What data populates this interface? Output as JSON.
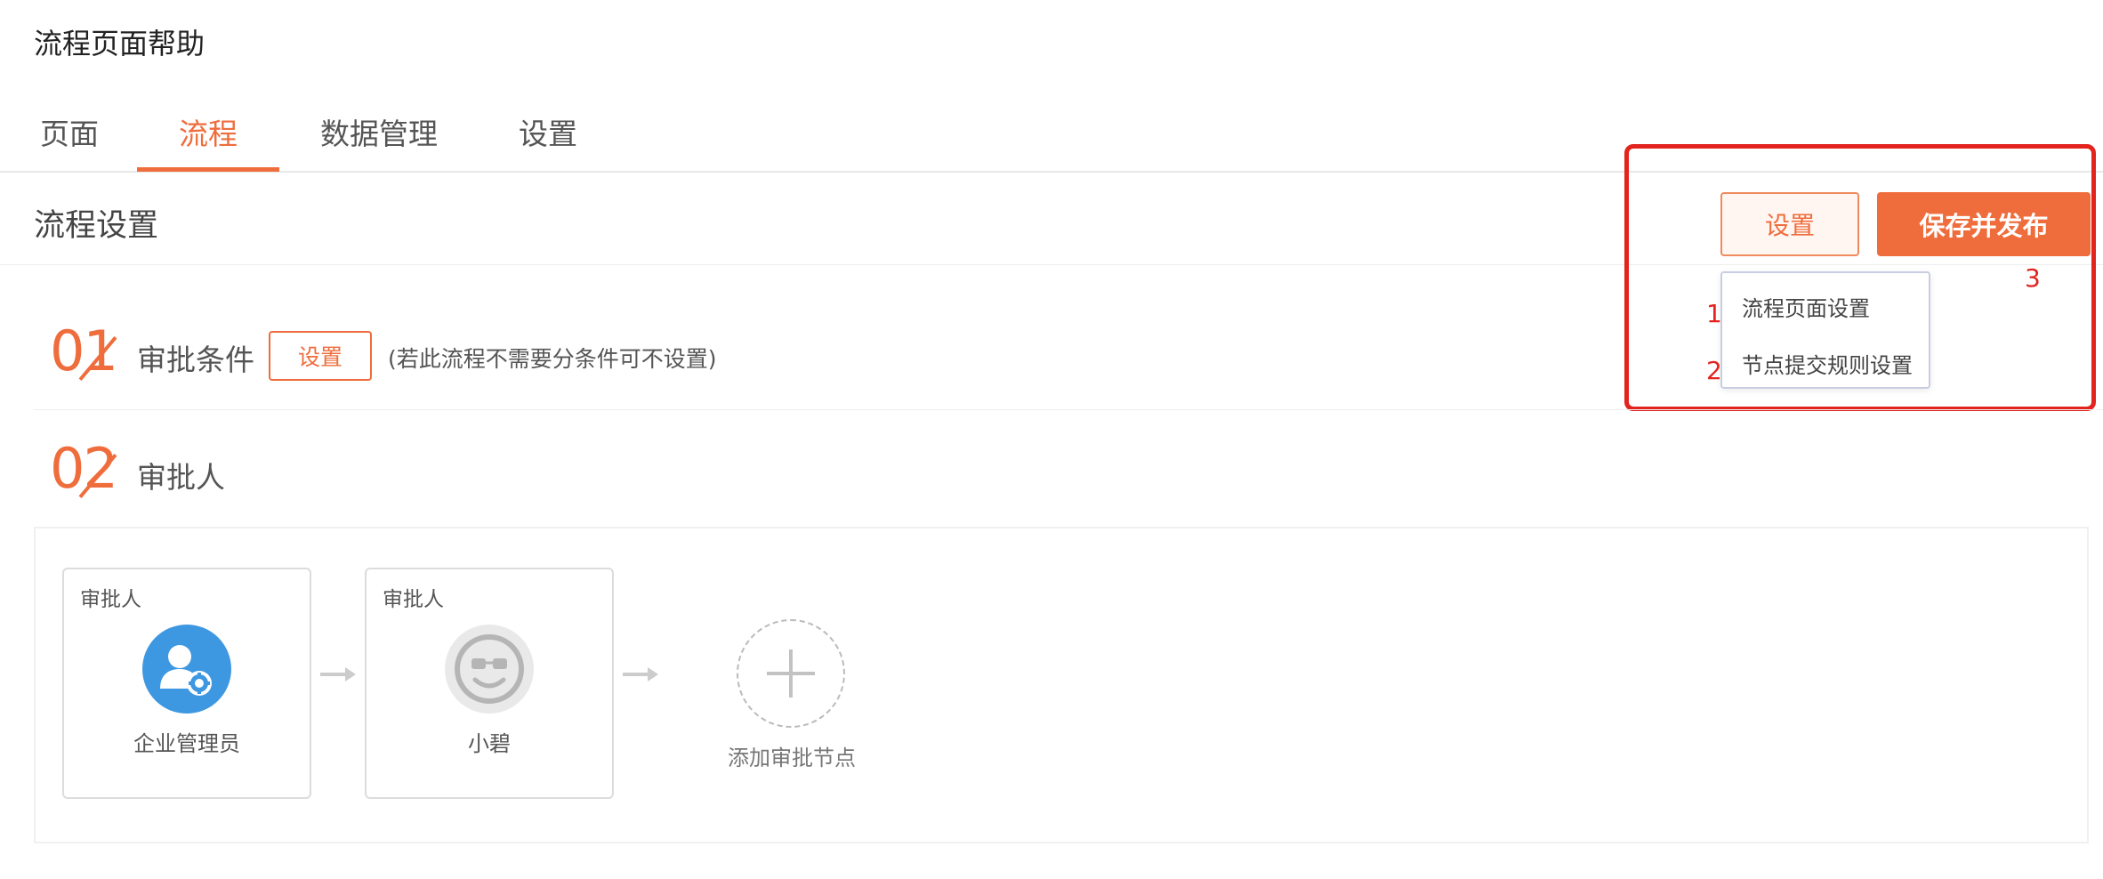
{
  "header": {
    "title": "流程页面帮助"
  },
  "tabs": [
    {
      "label": "页面"
    },
    {
      "label": "流程"
    },
    {
      "label": "数据管理"
    },
    {
      "label": "设置"
    }
  ],
  "toolbar": {
    "section_title": "流程设置",
    "settings_label": "设置",
    "publish_label": "保存并发布"
  },
  "dropdown": {
    "items": [
      {
        "label": "流程页面设置"
      },
      {
        "label": "节点提交规则设置"
      }
    ]
  },
  "annotations": {
    "n1": "1",
    "n2": "2",
    "n3": "3"
  },
  "steps": [
    {
      "number": "01",
      "label": "审批条件",
      "button": "设置",
      "note": "(若此流程不需要分条件可不设置)"
    },
    {
      "number": "02",
      "label": "审批人"
    }
  ],
  "flow": {
    "nodes": [
      {
        "title": "审批人",
        "name": "企业管理员",
        "icon": "admin-user-gear-icon"
      },
      {
        "title": "审批人",
        "name": "小碧",
        "icon": "smiley-face-icon"
      }
    ],
    "add_label": "添加审批节点"
  },
  "colors": {
    "accent": "#ef6d3c",
    "annotation": "#e3231e",
    "avatar_blue": "#3d97e1"
  }
}
